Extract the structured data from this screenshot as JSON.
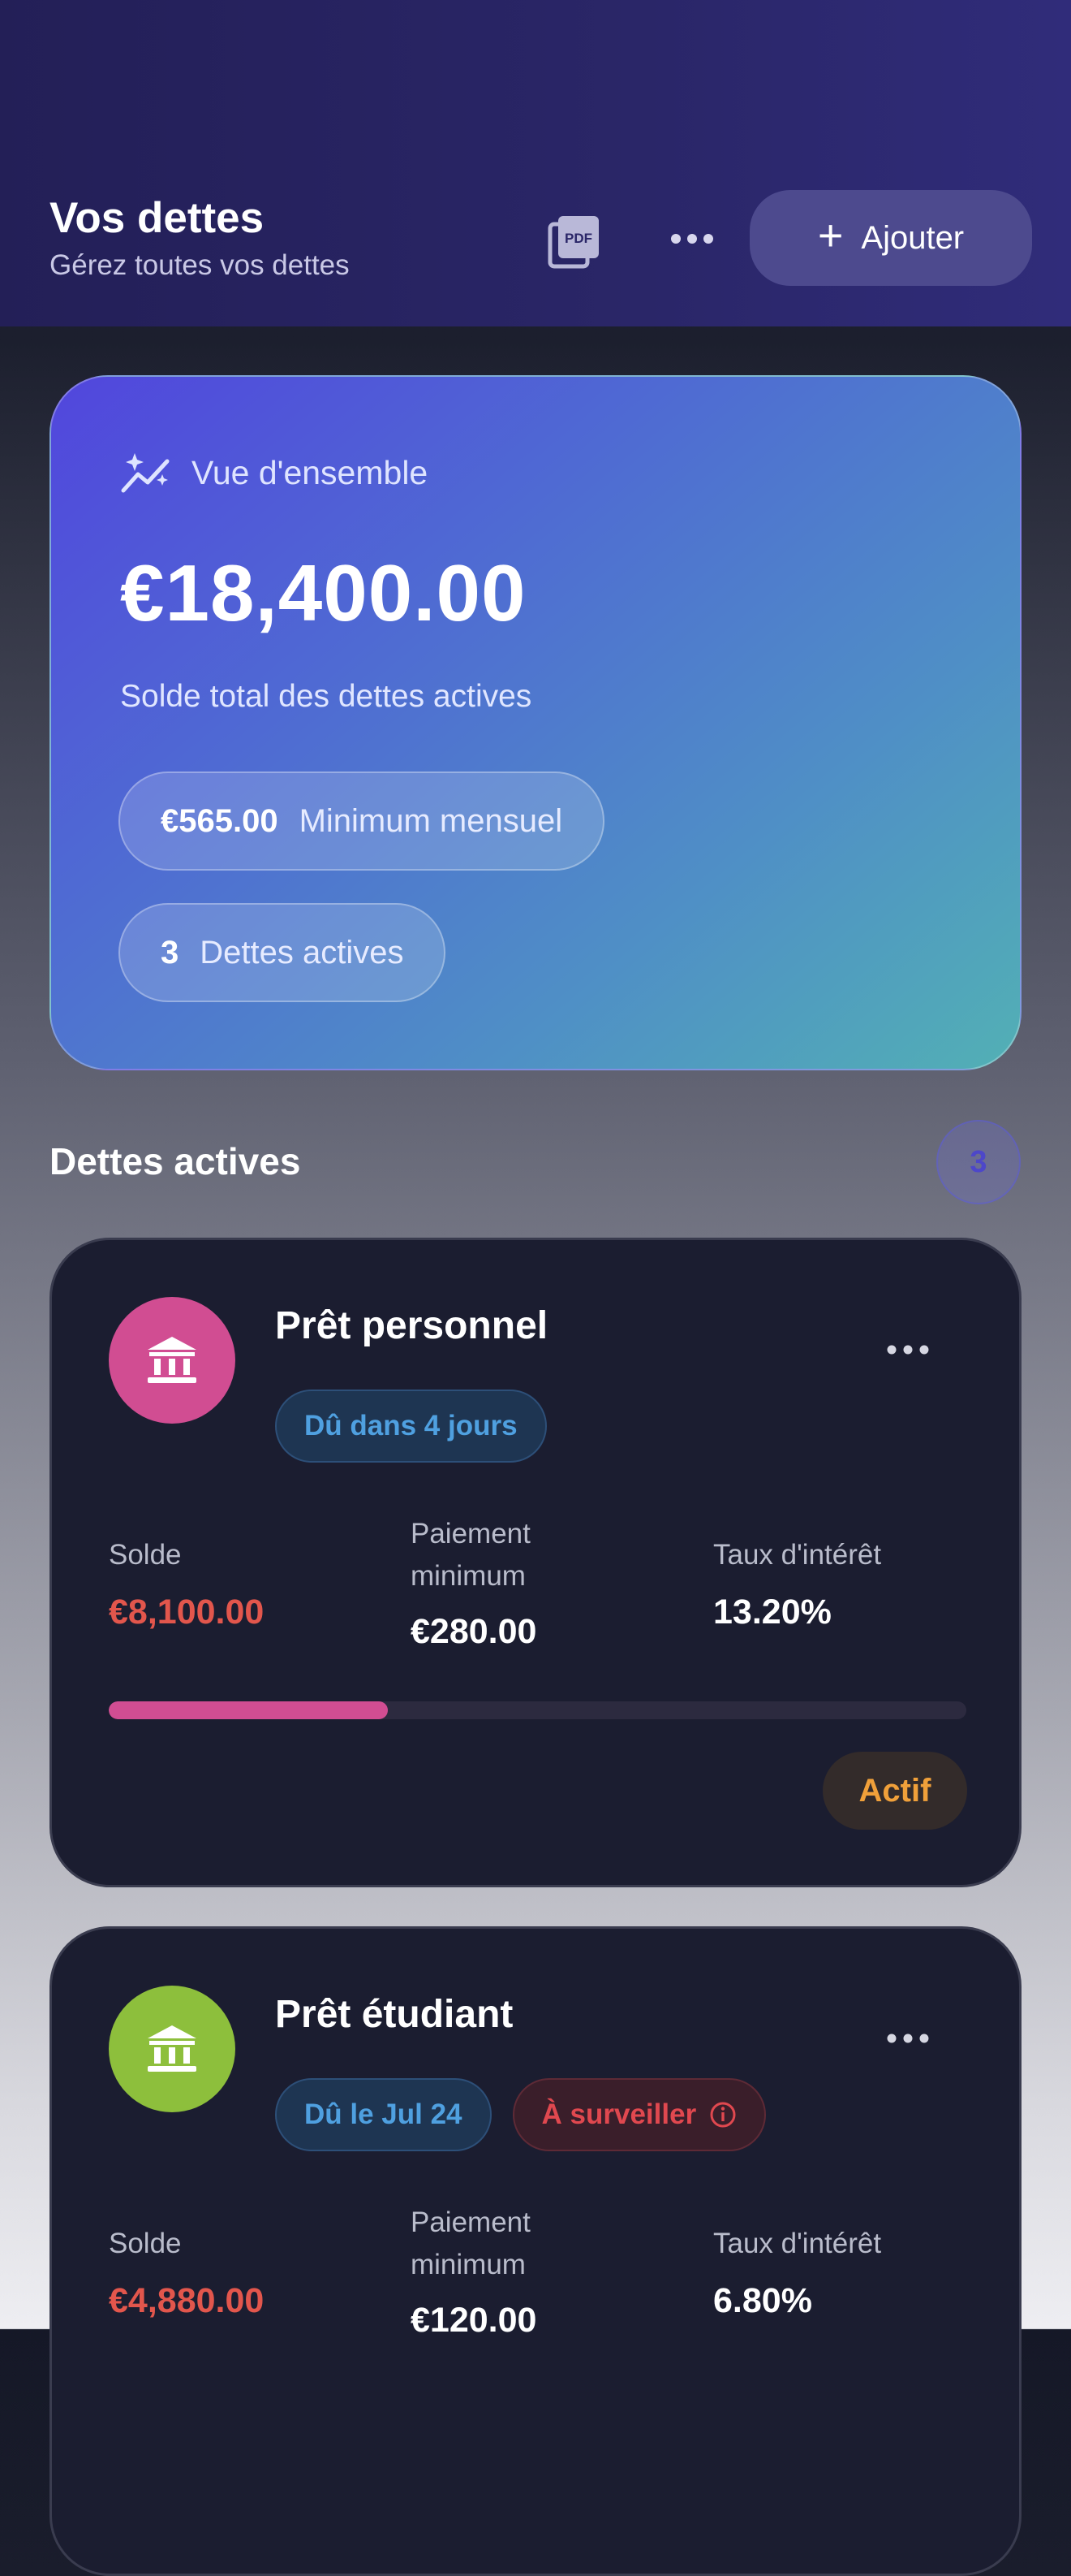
{
  "header": {
    "title": "Vos dettes",
    "subtitle": "Gérez toutes vos dettes",
    "pdf_icon": "pdf-export-icon",
    "more_icon": "more-horizontal-icon",
    "add_label": "Ajouter"
  },
  "overview": {
    "heading": "Vue d'ensemble",
    "icon": "sparkle-trend-icon",
    "total": "€18,400.00",
    "total_label": "Solde total des dettes actives",
    "min_value": "€565.00",
    "min_label": "Minimum mensuel",
    "count_value": "3",
    "count_label": "Dettes actives"
  },
  "section": {
    "title": "Dettes actives",
    "count": "3"
  },
  "debts": [
    {
      "name": "Prêt personnel",
      "icon": "bank-icon",
      "color": "#d14d92",
      "progress": 0.325,
      "tags": [
        "Dû dans 4 jours"
      ],
      "solde_label": "Solde",
      "solde": "€8,100.00",
      "min_label": "Paiement minimum",
      "min": "€280.00",
      "rate_label": "Taux d'intérêt",
      "rate": "13.20%",
      "status": "Actif"
    },
    {
      "name": "Prêt étudiant",
      "icon": "bank-icon",
      "color": "#8dbf3c",
      "tags": [
        "Dû le Jul 24",
        "À surveiller"
      ],
      "solde_label": "Solde",
      "solde": "€4,880.00",
      "min_label": "Paiement minimum",
      "min": "€120.00",
      "rate_label": "Taux d'intérêt",
      "rate": "6.80%"
    }
  ]
}
